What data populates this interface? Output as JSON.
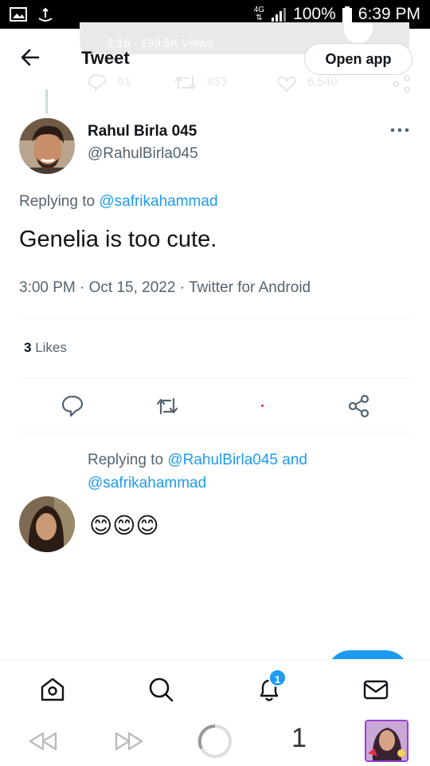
{
  "status_bar": {
    "network": "4G",
    "battery": "100%",
    "time": "6:39 PM"
  },
  "header": {
    "title": "Tweet",
    "open_app_label": "Open app",
    "ghost_card_text": "2:16 · 199.5K Views",
    "ghost_stats": {
      "replies": "91",
      "retweets": "933",
      "likes": "6,540"
    }
  },
  "tweet": {
    "display_name": "Rahul Birla 045",
    "handle": "@RahulBirla045",
    "replying_prefix": "Replying to",
    "replying_to": "@safrikahammad",
    "text": "Genelia is too cute.",
    "meta": "3:00 PM · Oct 15, 2022 · Twitter for Android",
    "likes_count": "3",
    "likes_label": "Likes"
  },
  "reply": {
    "replying_prefix": "Replying to",
    "mention_1": "@RahulBirla045",
    "and_word": "and",
    "mention_2": "@safrikahammad",
    "text": "😊😊😊"
  },
  "bottom_nav": {
    "notification_badge": "1"
  },
  "browser_bar": {
    "tab_count": "1"
  },
  "colors": {
    "accent": "#1d9bf0",
    "secondary_text": "#536471",
    "like_dot": "#f91880",
    "tab_border": "#9a3fd1"
  }
}
